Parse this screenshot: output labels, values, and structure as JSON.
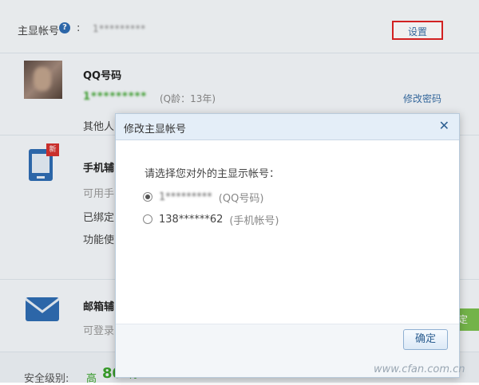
{
  "header": {
    "primary_account_label": "主显帐号",
    "help_icon": "help-circle-icon",
    "account_value": "1*********",
    "settings_button": "设置"
  },
  "qq_section": {
    "title": "QQ号码",
    "qq_number": "1*********",
    "qq_age": "(Q龄：13年)",
    "change_password": "修改密码",
    "other_text": "其他人"
  },
  "phone_section": {
    "title": "手机辅",
    "line1": "可用手",
    "line2": "已绑定",
    "line3": "功能使",
    "new_badge": "新",
    "icon": "phone-icon"
  },
  "mail_section": {
    "title": "邮箱辅",
    "line1": "可登录",
    "icon": "mail-icon",
    "green_button": "定"
  },
  "security": {
    "label": "安全级别:",
    "level_word": "高",
    "score": "80",
    "percent": "%"
  },
  "dialog": {
    "title": "修改主显帐号",
    "prompt": "请选择您对外的主显示帐号：",
    "options": [
      {
        "value": "1*********",
        "note": "(QQ号码)",
        "checked": true
      },
      {
        "value": "138******62",
        "note": "(手机帐号)",
        "checked": false
      }
    ],
    "ok_button": "确定"
  },
  "watermark": "www.cfan.com.cn"
}
